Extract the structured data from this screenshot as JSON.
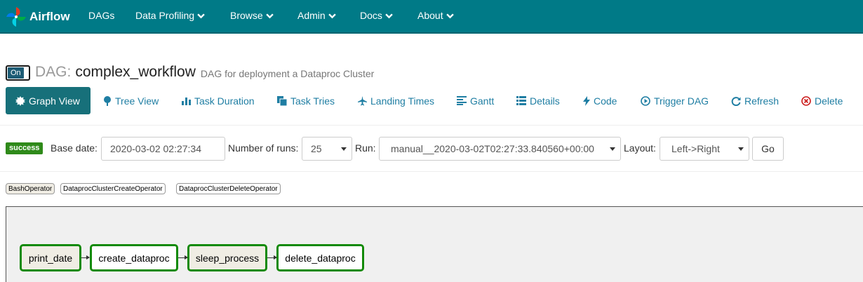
{
  "navbar": {
    "brand": "Airflow",
    "items": [
      {
        "label": "DAGs",
        "dropdown": false
      },
      {
        "label": "Data Profiling",
        "dropdown": true
      },
      {
        "label": "Browse",
        "dropdown": true
      },
      {
        "label": "Admin",
        "dropdown": true
      },
      {
        "label": "Docs",
        "dropdown": true
      },
      {
        "label": "About",
        "dropdown": true
      }
    ]
  },
  "header": {
    "toggle_label": "On",
    "dag_prefix": "DAG:",
    "dag_id": "complex_workflow",
    "description": "DAG for deployment a Dataproc Cluster"
  },
  "tabs": [
    {
      "label": "Graph View",
      "icon": "certificate-icon",
      "active": true
    },
    {
      "label": "Tree View",
      "icon": "tree-icon",
      "active": false
    },
    {
      "label": "Task Duration",
      "icon": "bar-chart-icon",
      "active": false
    },
    {
      "label": "Task Tries",
      "icon": "duplicate-icon",
      "active": false
    },
    {
      "label": "Landing Times",
      "icon": "plane-icon",
      "active": false
    },
    {
      "label": "Gantt",
      "icon": "align-left-icon",
      "active": false
    },
    {
      "label": "Details",
      "icon": "list-icon",
      "active": false
    },
    {
      "label": "Code",
      "icon": "flash-icon",
      "active": false
    },
    {
      "label": "Trigger DAG",
      "icon": "play-circle-icon",
      "active": false
    },
    {
      "label": "Refresh",
      "icon": "refresh-icon",
      "active": false
    },
    {
      "label": "Delete",
      "icon": "remove-circle-icon",
      "active": false
    }
  ],
  "form": {
    "status_badge": "success",
    "base_date_label": "Base date:",
    "base_date_value": "2020-03-02 02:27:34",
    "num_runs_label": "Number of runs:",
    "num_runs_value": "25",
    "run_label": "Run:",
    "run_value": "manual__2020-03-02T02:27:33.840560+00:00",
    "layout_label": "Layout:",
    "layout_value": "Left->Right",
    "go_label": "Go"
  },
  "legend": [
    "BashOperator",
    "DataprocClusterCreateOperator",
    "DataprocClusterDeleteOperator"
  ],
  "graph": {
    "nodes": [
      {
        "label": "print_date",
        "operator": "BashOperator",
        "state": "success"
      },
      {
        "label": "create_dataproc",
        "operator": "DataprocClusterCreateOperator",
        "state": "success"
      },
      {
        "label": "sleep_process",
        "operator": "BashOperator",
        "state": "success"
      },
      {
        "label": "delete_dataproc",
        "operator": "DataprocClusterDeleteOperator",
        "state": "success"
      }
    ]
  },
  "colors": {
    "navbar": "#007a87",
    "active_tab": "#17707a",
    "link": "#1f7ea3",
    "success": "#2f8a1a",
    "node_border": "#138a07",
    "bash_fill": "#f0ede4",
    "dataproc_fill": "#ffffff",
    "delete_red": "#cc1f1f"
  }
}
